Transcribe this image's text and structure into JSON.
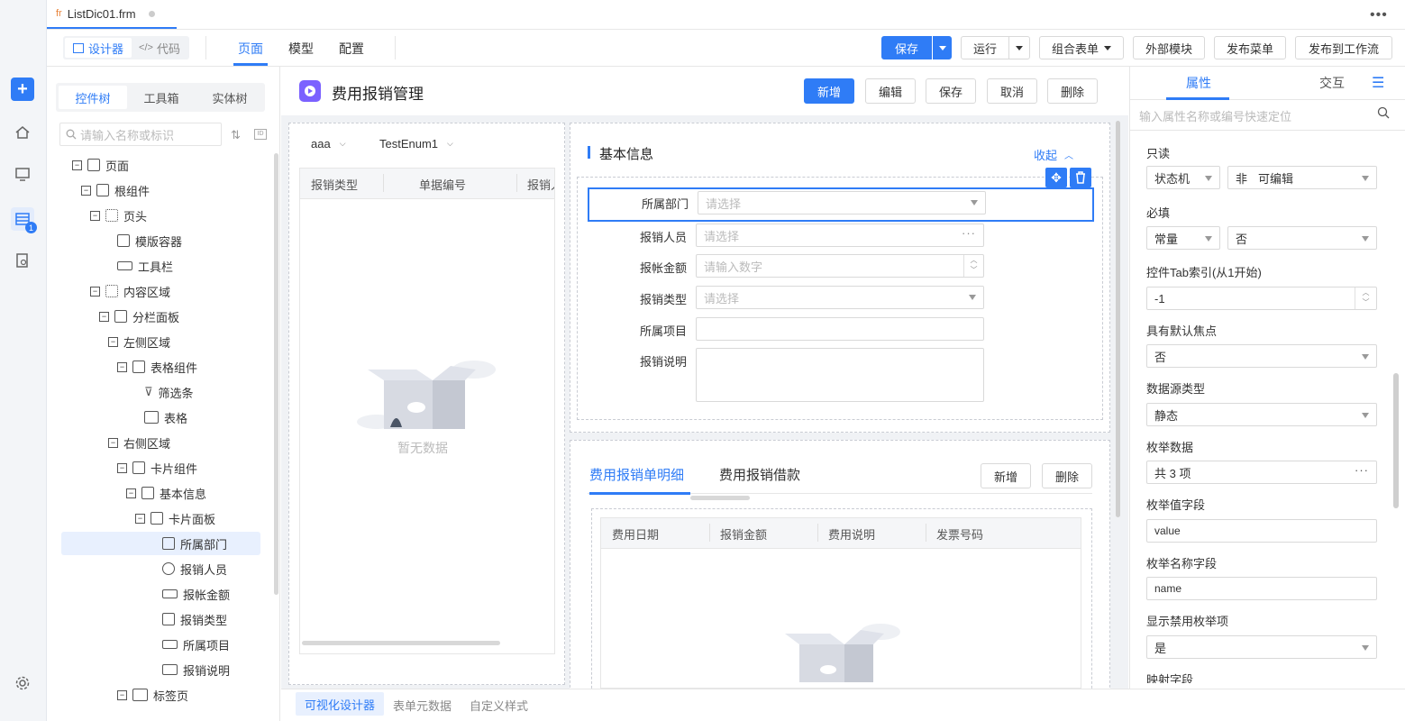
{
  "file_tab": {
    "icon": "fr",
    "name": "ListDic01.frm"
  },
  "topbar": {
    "more_icon": "ellipsis-icon"
  },
  "toolbar": {
    "designer_label": "设计器",
    "code_label": "代码",
    "tabs": [
      "页面",
      "模型",
      "配置"
    ],
    "save_label": "保存",
    "run_label": "运行",
    "combine_form_label": "组合表单",
    "external_module_label": "外部模块",
    "publish_menu_label": "发布菜单",
    "publish_workflow_label": "发布到工作流"
  },
  "rail": {
    "badge": "1"
  },
  "left_panel": {
    "tabs": [
      "控件树",
      "工具箱",
      "实体树"
    ],
    "search_placeholder": "请输入名称或标识",
    "tree": [
      {
        "label": "页面"
      },
      {
        "label": "根组件"
      },
      {
        "label": "页头"
      },
      {
        "label": "模版容器"
      },
      {
        "label": "工具栏"
      },
      {
        "label": "内容区域"
      },
      {
        "label": "分栏面板"
      },
      {
        "label": "左侧区域"
      },
      {
        "label": "表格组件"
      },
      {
        "label": "筛选条"
      },
      {
        "label": "表格"
      },
      {
        "label": "右侧区域"
      },
      {
        "label": "卡片组件"
      },
      {
        "label": "基本信息"
      },
      {
        "label": "卡片面板"
      },
      {
        "label": "所属部门"
      },
      {
        "label": "报销人员"
      },
      {
        "label": "报帐金额"
      },
      {
        "label": "报销类型"
      },
      {
        "label": "所属项目"
      },
      {
        "label": "报销说明"
      },
      {
        "label": "标签页"
      }
    ]
  },
  "canvas": {
    "page_title": "费用报销管理",
    "header_buttons": [
      "新增",
      "编辑",
      "保存",
      "取消",
      "删除"
    ],
    "filter": {
      "field1": "aaa",
      "field2": "TestEnum1"
    },
    "left_table": {
      "columns": [
        "报销类型",
        "单据编号",
        "报销人"
      ],
      "empty_text": "暂无数据"
    },
    "basic_info": {
      "title": "基本信息",
      "collapse_label": "收起",
      "fields": [
        {
          "label": "所属部门",
          "placeholder": "请选择"
        },
        {
          "label": "报销人员",
          "placeholder": "请选择"
        },
        {
          "label": "报帐金额",
          "placeholder": "请输入数字"
        },
        {
          "label": "报销类型",
          "placeholder": "请选择"
        },
        {
          "label": "所属项目",
          "placeholder": ""
        },
        {
          "label": "报销说明",
          "placeholder": ""
        }
      ]
    },
    "detail_tabs": [
      "费用报销单明细",
      "费用报销借款"
    ],
    "detail_buttons": [
      "新增",
      "删除"
    ],
    "detail_table": {
      "columns": [
        "费用日期",
        "报销金额",
        "费用说明",
        "发票号码"
      ]
    }
  },
  "right_panel": {
    "tabs": [
      "属性",
      "交互"
    ],
    "search_placeholder": "输入属性名称或编号快速定位",
    "properties": [
      {
        "label": "只读",
        "mode": "状态机",
        "value_prefix": "非",
        "value": "可编辑"
      },
      {
        "label": "必填",
        "mode": "常量",
        "value": "否"
      },
      {
        "label": "控件Tab索引(从1开始)",
        "value": "-1"
      },
      {
        "label": "具有默认焦点",
        "value": "否"
      },
      {
        "label": "数据源类型",
        "value": "静态"
      },
      {
        "label": "枚举数据",
        "value": "共 3 项"
      },
      {
        "label": "枚举值字段",
        "value": "value"
      },
      {
        "label": "枚举名称字段",
        "value": "name"
      },
      {
        "label": "显示禁用枚举项",
        "value": "是"
      },
      {
        "label": "映射字段",
        "value": ""
      }
    ]
  },
  "bottom_tabs": [
    "可视化设计器",
    "表单元数据",
    "自定义样式"
  ],
  "colors": {
    "accent": "#2f7cf6",
    "selection_bg": "#e8f0fe"
  }
}
